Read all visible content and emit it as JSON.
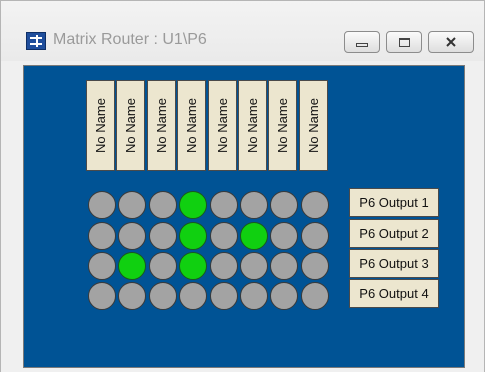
{
  "window": {
    "title": "Matrix Router : U1\\P6",
    "controls": {
      "minimize": "minimize",
      "maximize": "maximize",
      "close": "close"
    }
  },
  "inputs": [
    "No Name",
    "No Name",
    "No Name",
    "No Name",
    "No Name",
    "No Name",
    "No Name",
    "No Name"
  ],
  "outputs": [
    "P6 Output 1",
    "P6 Output 2",
    "P6 Output 3",
    "P6 Output 4"
  ],
  "crosspoints": [
    [
      false,
      false,
      false,
      true,
      false,
      false,
      false,
      false
    ],
    [
      false,
      false,
      false,
      true,
      false,
      true,
      false,
      false
    ],
    [
      false,
      true,
      false,
      true,
      false,
      false,
      false,
      false
    ],
    [
      false,
      false,
      false,
      false,
      false,
      false,
      false,
      false
    ]
  ],
  "colors": {
    "background": "#005395",
    "active": "#10d010",
    "inactive": "#a3a3a3",
    "label": "#ece6cf"
  },
  "icons": {
    "app": "matrix-router-icon",
    "close": "close-icon"
  }
}
